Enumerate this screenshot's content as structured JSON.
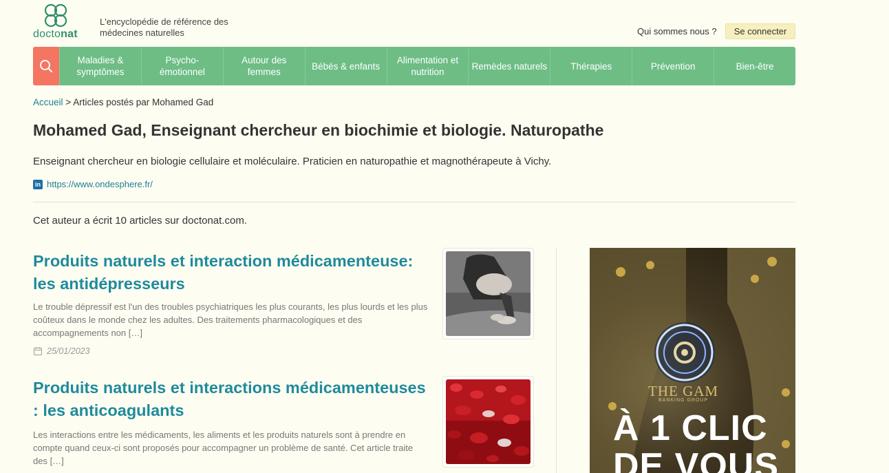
{
  "header": {
    "logo_text_regular": "docto",
    "logo_text_bold": "nat",
    "tagline_line1": "L'encyclopédie de référence des",
    "tagline_line2": "médecines naturelles",
    "about_link": "Qui sommes nous ?",
    "login_button": "Se connecter"
  },
  "nav": {
    "search_icon": "search-icon",
    "items": [
      "Maladies & symptômes",
      "Psycho-émotionnel",
      "Autour des femmes",
      "Bébés & enfants",
      "Alimentation et nutrition",
      "Remèdes naturels",
      "Thérapies",
      "Prévention",
      "Bien-être"
    ]
  },
  "breadcrumb": {
    "home": "Accueil",
    "separator": ">",
    "current": "Articles postés par Mohamed Gad"
  },
  "author": {
    "title": "Mohamed Gad, Enseignant chercheur en biochimie et biologie. Naturopathe",
    "bio": "Enseignant chercheur en biologie cellulaire et moléculaire. Praticien en naturopathie et magnothérapeute à Vichy.",
    "social_icon": "linkedin-icon",
    "website": "https://www.ondesphere.fr/",
    "article_count_text": "Cet auteur a écrit 10 articles sur doctonat.com."
  },
  "articles": [
    {
      "title": "Produits naturels et interaction médicamenteuse: les antidépresseurs",
      "excerpt": "Le trouble dépressif est l'un des troubles psychiatriques les plus courants, les plus lourds et les plus coûteux dans le monde chez les adultes. Des traitements pharmacologiques et des accompagnements non […]",
      "date": "25/01/2023"
    },
    {
      "title": "Produits naturels et interactions médicamenteuses : les anticoagulants",
      "excerpt": "Les interactions entre les médicaments, les aliments et les produits naturels sont à prendre en compte quand ceux-ci sont proposés pour accompagner un problème de santé. Cet article traite des […]",
      "date": ""
    }
  ],
  "ad": {
    "brand_line1": "THE GAM",
    "brand_line2": "BANKING GROUP",
    "headline_line1": "À 1 CLIC",
    "headline_line2": "DE VOUS"
  },
  "colors": {
    "background": "#fefdf2",
    "nav_green": "#6dbd85",
    "search_coral": "#f47561",
    "link_teal": "#1f8a9c",
    "login_yellow": "#f6efbf"
  }
}
